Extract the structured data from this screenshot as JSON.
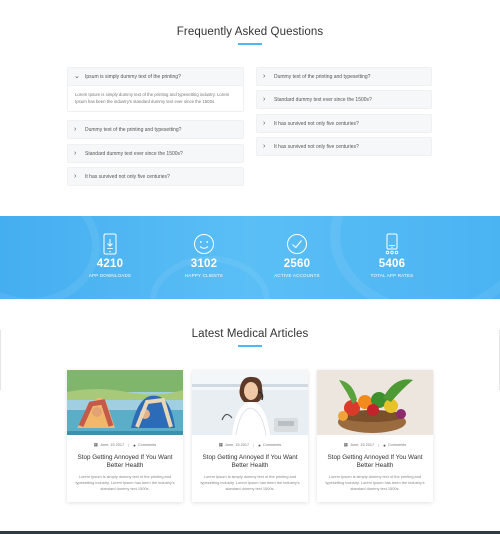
{
  "faq": {
    "title": "Frequently Asked Questions",
    "left": [
      {
        "question": "Ipsum is simply dummy text of the printing?",
        "open": true,
        "answer": "Lorem Ipsum is simply dummy text of the printing and typesetting industry. Lorem Ipsum has been the industry's standard dummy text ever since the 1500s."
      },
      {
        "question": "Dummy text of the printing and typesetting?"
      },
      {
        "question": "Standard dummy text ever since the 1500s?"
      },
      {
        "question": "It has survived not only five centuries?"
      }
    ],
    "right": [
      {
        "question": "Dummy text of the printing and typesetting?"
      },
      {
        "question": "Standard dummy text ever since the 1500s?"
      },
      {
        "question": "It has survived not only five centuries?"
      },
      {
        "question": "It has survived not only five centuries?"
      }
    ]
  },
  "stats": [
    {
      "icon": "mobile-download-icon",
      "number": "4210",
      "label": "APP DOWNLOADS"
    },
    {
      "icon": "smiley-icon",
      "number": "3102",
      "label": "HAPPY CLIENTS"
    },
    {
      "icon": "check-circle-icon",
      "number": "2560",
      "label": "ACTIVE ACCOUNTS"
    },
    {
      "icon": "mobile-rating-icon",
      "number": "5406",
      "label": "TOTAL APP RATES"
    }
  ],
  "articles": {
    "title": "Latest Medical Articles",
    "items": [
      {
        "image": "yoga-kids",
        "date": "June, 15 2017",
        "comments": "Comments",
        "title": "Stop Getting Annoyed If You Want Better Health",
        "excerpt": "Lorem Ipsum is simply dummy text of the printing and typesetting industry. Lorem Ipsum has been the industry's standard dummy text 1500s."
      },
      {
        "image": "doctor-phone",
        "date": "June, 15 2017",
        "comments": "Comments",
        "title": "Stop Getting Annoyed If You Want Better Health",
        "excerpt": "Lorem Ipsum is simply dummy text of the printing and typesetting industry. Lorem Ipsum has been the industry's standard dummy text 1500s."
      },
      {
        "image": "vegetables-basket",
        "date": "June, 15 2017",
        "comments": "Comments",
        "title": "Stop Getting Annoyed If You Want Better Health",
        "excerpt": "Lorem Ipsum is simply dummy text of the printing and typesetting industry. Lorem Ipsum has been the industry's standard dummy text 1500s."
      }
    ]
  },
  "colors": {
    "accent": "#4fb8f2",
    "band": "#51b7f4",
    "footer": "#2d3a43"
  }
}
